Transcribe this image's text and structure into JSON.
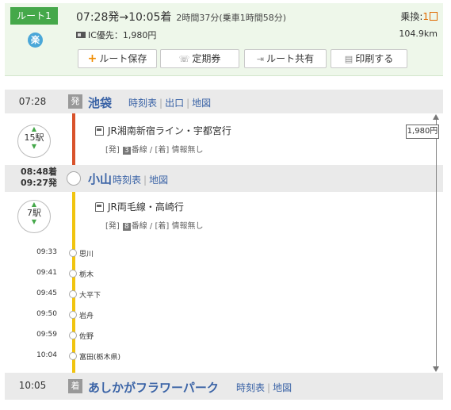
{
  "summary": {
    "route_label": "ルート1",
    "raku_label": "楽",
    "times": "07:28発→10:05着",
    "duration": "2時間37分(乗車1時間58分)",
    "transfer_label": "乗換:",
    "transfer_count": "1",
    "fare": "IC優先：1,980円",
    "distance": "104.9km",
    "buttons": {
      "save": "ルート保存",
      "commuter": "定期券",
      "share": "ルート共有",
      "print": "印刷する"
    }
  },
  "stations": [
    {
      "time": "07:28",
      "badge": "発",
      "name": "池袋",
      "links": [
        "時刻表",
        "出口",
        "地図"
      ]
    },
    {
      "arrive": "08:48着",
      "depart": "09:27発",
      "name": "小山",
      "links": [
        "時刻表",
        "地図"
      ]
    },
    {
      "time": "10:05",
      "badge": "着",
      "name": "あしかがフラワーパーク",
      "links": [
        "時刻表",
        "地図"
      ]
    }
  ],
  "segments": [
    {
      "stops": "15駅",
      "train": "JR湘南新宿ライン・宇都宮行",
      "dep_label": "[発]",
      "platform": "3",
      "platform_suffix": "番線 / [着] 情報無し"
    },
    {
      "stops": "7駅",
      "train": "JR両毛線・高崎行",
      "dep_label": "[発]",
      "platform": "8",
      "platform_suffix": "番線 / [着] 情報無し"
    }
  ],
  "fare_box": "1,980円",
  "intermediate_stops": [
    {
      "time": "09:33",
      "name": "思川"
    },
    {
      "time": "09:41",
      "name": "栃木"
    },
    {
      "time": "09:45",
      "name": "大平下"
    },
    {
      "time": "09:50",
      "name": "岩舟"
    },
    {
      "time": "09:59",
      "name": "佐野"
    },
    {
      "time": "10:04",
      "name": "富田(栃木県)"
    }
  ],
  "colors": {
    "accent_green": "#45a84a",
    "line_red": "#d9532b",
    "line_yellow": "#f1c40f",
    "link_blue": "#3a63a6"
  }
}
